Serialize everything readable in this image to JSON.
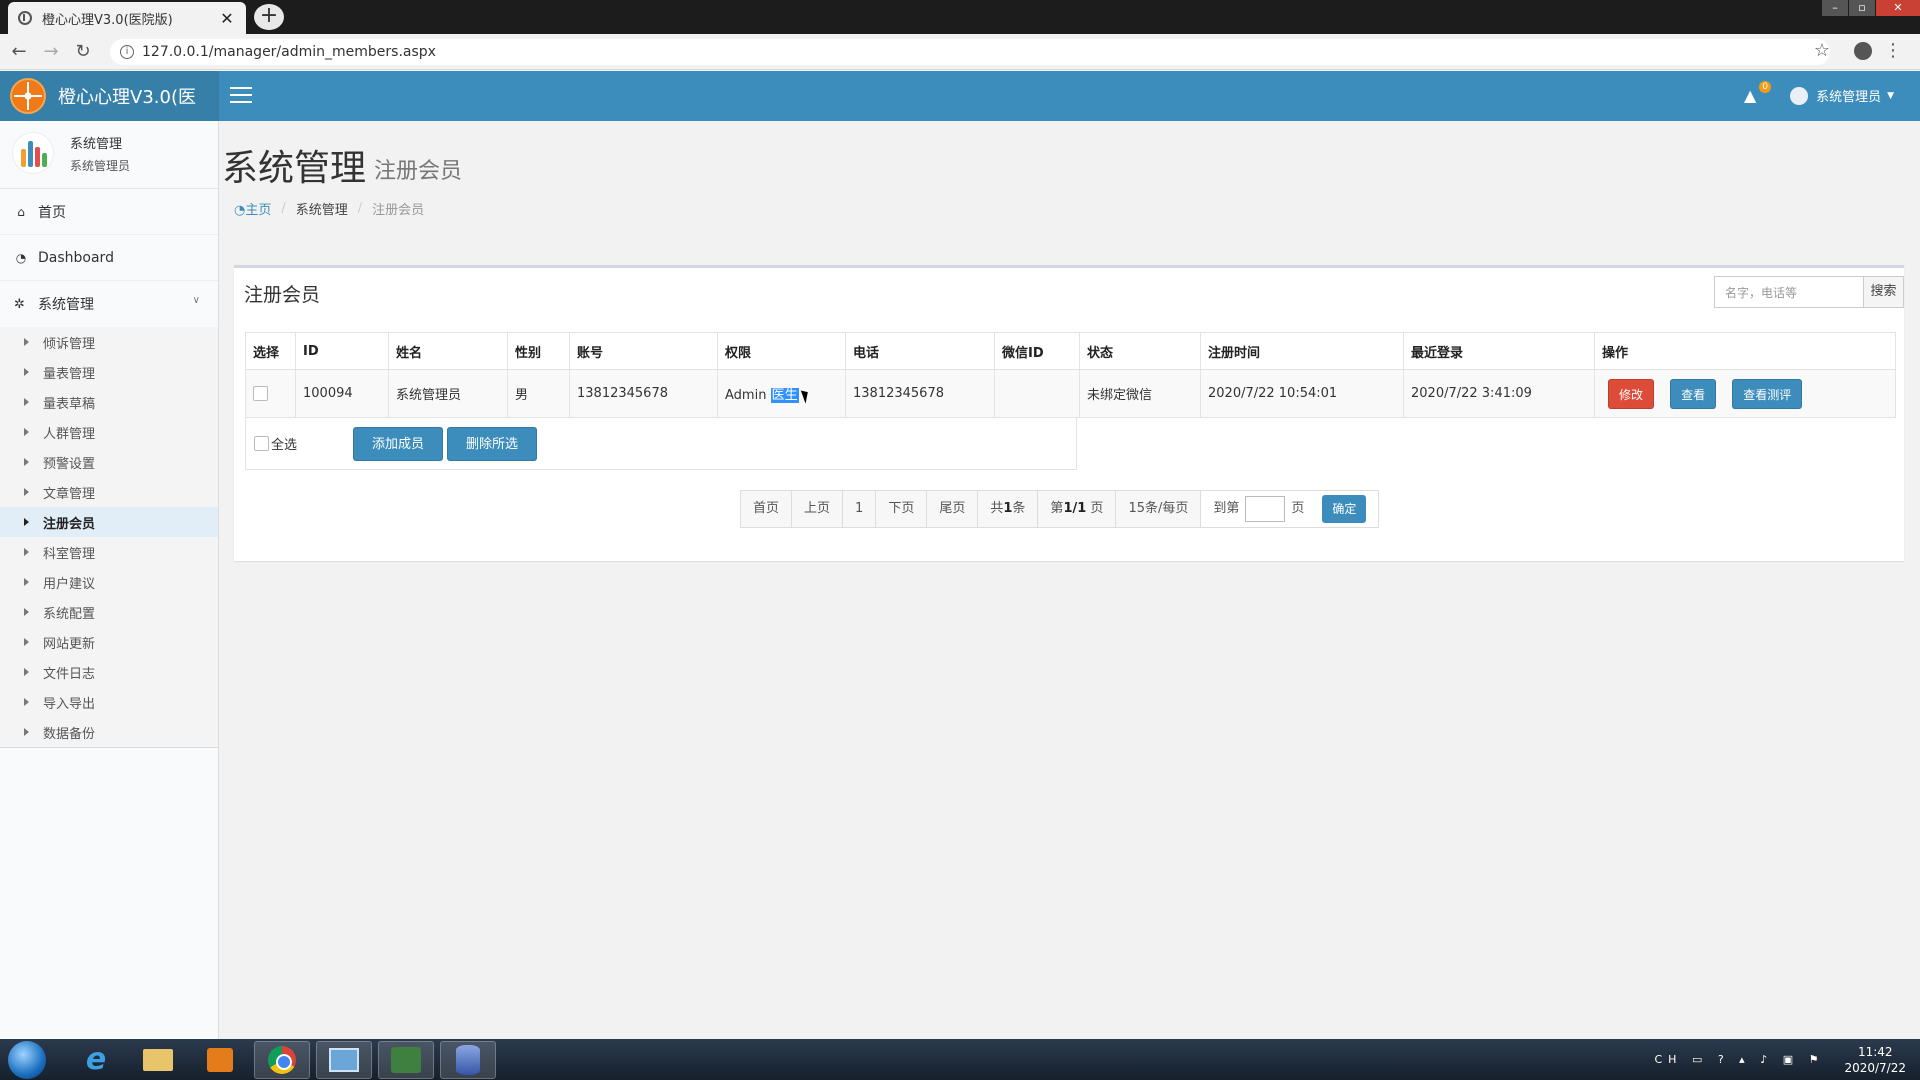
{
  "browser": {
    "tab_title": "橙心心理V3.0(医院版)",
    "tab_close": "✕",
    "new_tab": "+",
    "url": "127.0.0.1/manager/admin_members.aspx"
  },
  "header": {
    "app_name": "橙心心理V3.0(医",
    "notification_count": "0",
    "user_menu_label": "系统管理员"
  },
  "sidebar": {
    "user_name": "系统管理",
    "user_role": "系统管理员",
    "top_items": [
      {
        "label": "首页",
        "icon": "home-icon"
      },
      {
        "label": "Dashboard",
        "icon": "dashboard-icon"
      }
    ],
    "group": {
      "label": "系统管理",
      "icon": "gear-icon"
    },
    "sub_items": [
      {
        "label": "倾诉管理"
      },
      {
        "label": "量表管理"
      },
      {
        "label": "量表草稿"
      },
      {
        "label": "人群管理"
      },
      {
        "label": "预警设置"
      },
      {
        "label": "文章管理"
      },
      {
        "label": "注册会员",
        "active": true
      },
      {
        "label": "科室管理"
      },
      {
        "label": "用户建议"
      },
      {
        "label": "系统配置"
      },
      {
        "label": "网站更新"
      },
      {
        "label": "文件日志"
      },
      {
        "label": "导入导出"
      },
      {
        "label": "数据备份"
      }
    ]
  },
  "page": {
    "title": "系统管理",
    "subtitle": "注册会员",
    "breadcrumb": {
      "home": "主页",
      "section": "系统管理",
      "current": "注册会员"
    }
  },
  "box": {
    "title": "注册会员",
    "search_placeholder": "名字，电话等",
    "search_button": "搜索"
  },
  "table": {
    "columns": [
      "选择",
      "ID",
      "姓名",
      "性别",
      "账号",
      "权限",
      "电话",
      "微信ID",
      "状态",
      "注册时间",
      "最近登录",
      "操作"
    ],
    "rows": [
      {
        "id": "100094",
        "name": "系统管理员",
        "gender": "男",
        "account": "13812345678",
        "role": "Admin",
        "role_selected": "医生",
        "phone": "13812345678",
        "wechat_id": "",
        "status": "未绑定微信",
        "registered": "2020/7/22 10:54:01",
        "last_login": "2020/7/22 3:41:09",
        "actions": {
          "edit": "修改",
          "view": "查看",
          "view_eval": "查看测评"
        }
      }
    ]
  },
  "footer": {
    "select_all": "全选",
    "add_member": "添加成员",
    "delete_selected": "删除所选"
  },
  "pager": {
    "first": "首页",
    "prev": "上页",
    "current_page": "1",
    "next": "下页",
    "last": "尾页",
    "total_prefix": "共",
    "total_count": "1",
    "total_suffix": "条",
    "page_prefix": "第",
    "page_info": "1/1",
    "page_suffix": "页",
    "per_page": "15条/每页",
    "goto_label": "到第",
    "goto_suffix": "页",
    "confirm": "确定"
  },
  "taskbar": {
    "tray_lang": "CH",
    "time": "11:42",
    "date": "2020/7/22"
  },
  "colors": {
    "header_blue": "#3c8dbc",
    "logo_bar": "#367fa9",
    "danger": "#dd4b39",
    "sidebar_active_bg": "#e1eef7"
  }
}
